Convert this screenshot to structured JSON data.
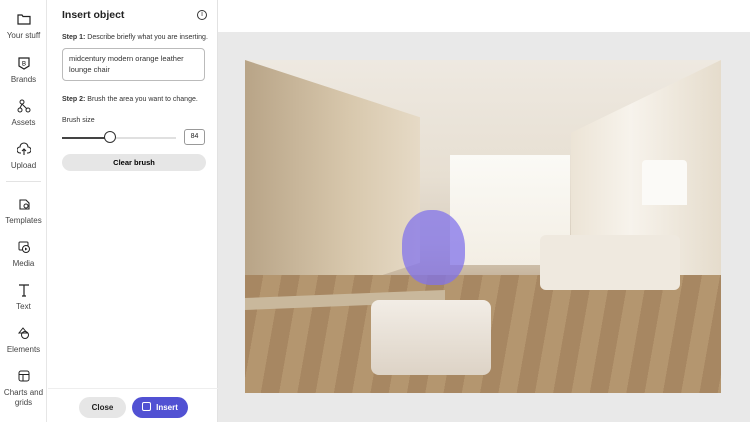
{
  "rail": [
    {
      "label": "Your stuff",
      "icon": "folder-icon"
    },
    {
      "label": "Brands",
      "icon": "brand-icon"
    },
    {
      "label": "Assets",
      "icon": "assets-icon"
    },
    {
      "label": "Upload",
      "icon": "upload-icon"
    },
    {
      "label": "Templates",
      "icon": "templates-icon"
    },
    {
      "label": "Media",
      "icon": "media-icon"
    },
    {
      "label": "Text",
      "icon": "text-icon"
    },
    {
      "label": "Elements",
      "icon": "elements-icon"
    },
    {
      "label": "Charts and grids",
      "icon": "charts-grids-icon"
    }
  ],
  "panel": {
    "title": "Insert object",
    "step1_label": "Step 1:",
    "step1_text": " Describe briefly what you are inserting.",
    "description": "midcentury modern orange leather lounge chair",
    "step2_label": "Step 2:",
    "step2_text": " Brush the area you want to change.",
    "brush_size_label": "Brush size",
    "brush_size": "84",
    "brush_fraction": 0.42,
    "clear_label": "Clear brush",
    "close_label": "Close",
    "insert_label": "Insert"
  },
  "colors": {
    "accent": "#5151d3",
    "brush": "#8273eb"
  }
}
